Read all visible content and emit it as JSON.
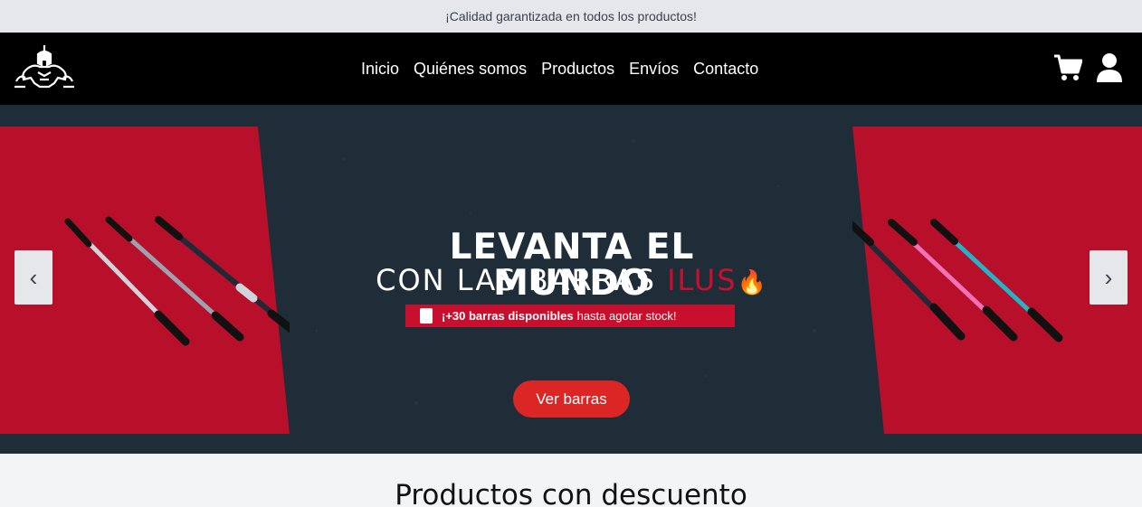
{
  "topbar": {
    "text": "¡Calidad garantizada en todos los productos!"
  },
  "navbar": {
    "logo_icon": "spartan-logo-icon",
    "links": [
      "Inicio",
      "Quiénes somos",
      "Productos",
      "Envíos",
      "Contacto"
    ],
    "cart_icon": "cart-icon",
    "user_icon": "user-icon"
  },
  "hero": {
    "headline": "LEVANTA EL MUNDO",
    "subline_prefix": "CON LAS BARRAS ",
    "subline_brand": "ILUS",
    "subline_emoji": "🔥",
    "badge_bold": "¡+30 barras disponibles",
    "badge_rest": "hasta agotar stock!",
    "cta": "Ver barras",
    "prev": "‹",
    "next": "›"
  },
  "section": {
    "title": "Productos con descuento"
  },
  "colors": {
    "accent": "#dc2626",
    "brand_red": "#c8102e",
    "hero_bg": "#1f2d38",
    "nav_bg": "#000000"
  }
}
